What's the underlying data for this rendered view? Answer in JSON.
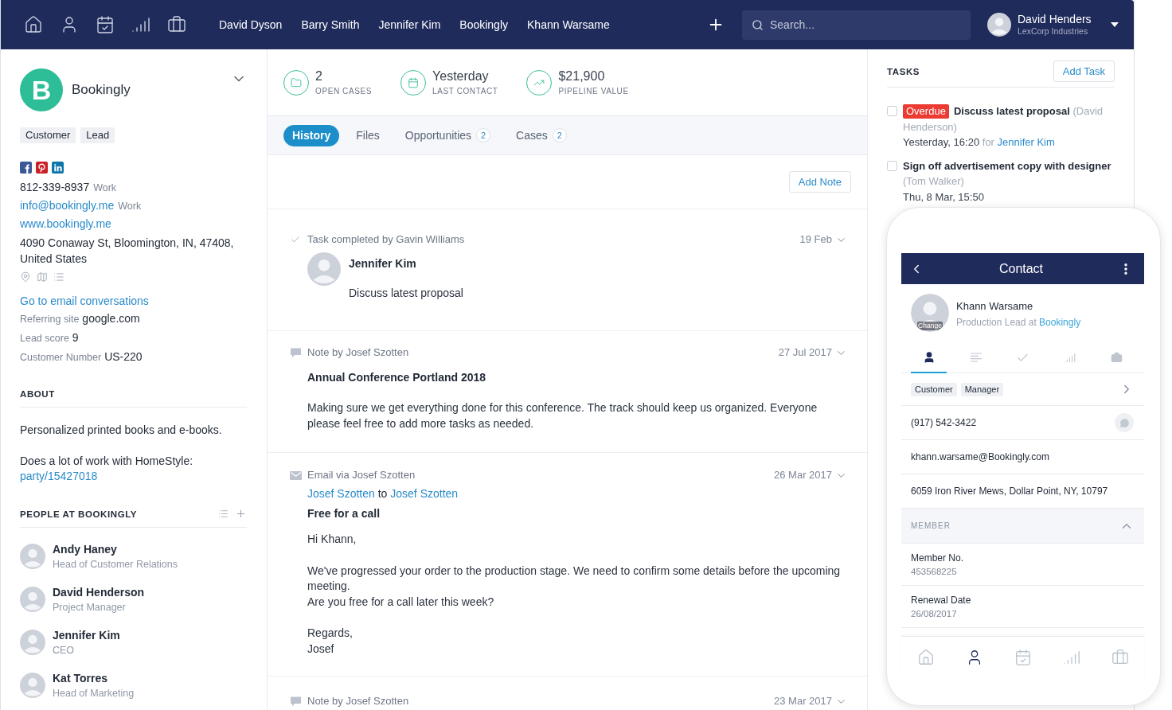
{
  "top_nav": {
    "links": [
      "David Dyson",
      "Barry Smith",
      "Jennifer Kim",
      "Bookingly",
      "Khann Warsame"
    ],
    "search": {
      "placeholder": "Search..."
    },
    "user": {
      "name": "David Henders",
      "company": "LexCorp Industries"
    }
  },
  "company": {
    "initial": "B",
    "name": "Bookingly",
    "tags": [
      "Customer",
      "Lead"
    ],
    "phone": {
      "number": "812-339-8937",
      "type": "Work"
    },
    "email": {
      "address": "info@bookingly.me",
      "type": "Work"
    },
    "website": "www.bookingly.me",
    "address": "4090 Conaway St, Bloomington, IN, 47408, United States",
    "email_link": "Go to email conversations",
    "fields": [
      {
        "label": "Referring site",
        "value": "google.com"
      },
      {
        "label": "Lead score",
        "value": "9"
      },
      {
        "label": "Customer Number",
        "value": "US-220"
      }
    ]
  },
  "about": {
    "heading": "ABOUT",
    "paragraphs": [
      {
        "text": "Personalized printed books and e-books."
      },
      {
        "text": "Does a lot of work with HomeStyle:",
        "link": "party/15427018"
      }
    ]
  },
  "people": {
    "heading": "PEOPLE AT BOOKINGLY",
    "items": [
      {
        "name": "Andy Haney",
        "role": "Head of Customer Relations"
      },
      {
        "name": "David Henderson",
        "role": "Project Manager"
      },
      {
        "name": "Jennifer Kim",
        "role": "CEO"
      },
      {
        "name": "Kat Torres",
        "role": "Head of Marketing"
      }
    ]
  },
  "stats": [
    {
      "value": "2",
      "label": "OPEN CASES"
    },
    {
      "value": "Yesterday",
      "label": "LAST CONTACT"
    },
    {
      "value": "$21,900",
      "label": "PIPELINE VALUE"
    }
  ],
  "tabs": [
    {
      "label": "History",
      "selected": true
    },
    {
      "label": "Files",
      "selected": false
    },
    {
      "label": "Opportunities",
      "count": "2",
      "selected": false
    },
    {
      "label": "Cases",
      "count": "2",
      "selected": false
    }
  ],
  "add_note": "Add Note",
  "history": [
    {
      "kind": "task",
      "header": "Task completed by Gavin Williams",
      "date": "19 Feb",
      "person": "Jennifer Kim",
      "text": "Discuss latest proposal"
    },
    {
      "kind": "note",
      "header": "Note by Josef Szotten",
      "date": "27 Jul 2017",
      "title": "Annual Conference Portland 2018",
      "body": "Making sure we get everything done for this conference. The track should keep us organized. Everyone please feel free to add more tasks as needed."
    },
    {
      "kind": "email",
      "header": "Email via Josef Szotten",
      "date": "26 Mar 2017",
      "from": "Josef Szotten",
      "connector": "to",
      "to": "Josef Szotten",
      "title": "Free for a call",
      "paragraphs": [
        [
          "Hi Khann,"
        ],
        [
          "We've progressed your order to the production stage. We need to confirm some details before the upcoming meeting.",
          "Are you free for a call later this week?"
        ],
        [
          "Regards,",
          "Josef"
        ]
      ]
    },
    {
      "kind": "note",
      "header": "Note by Josef Szotten",
      "date": "23 Mar 2017"
    }
  ],
  "tasks": {
    "heading": "TASKS",
    "add_button": "Add Task",
    "items": [
      {
        "checked": false,
        "badge": "Overdue",
        "title": "Discuss latest proposal",
        "assignee": "(David Henderson)",
        "due": "Yesterday, 16:20",
        "for": "for",
        "contact": "Jennifer Kim"
      },
      {
        "checked": false,
        "title": "Sign off advertisement copy with designer",
        "assignee": "(Tom Walker)",
        "due": "Thu, 8 Mar, 15:50"
      }
    ]
  },
  "mobile": {
    "title": "Contact",
    "contact": {
      "name": "Khann Warsame",
      "role": "Production Lead at",
      "company": "Bookingly",
      "photo_action": "Change"
    },
    "tabs": [
      {
        "selected": true
      },
      {
        "selected": false
      },
      {
        "selected": false
      },
      {
        "selected": false
      },
      {
        "selected": false
      }
    ],
    "tags": [
      "Customer",
      "Manager"
    ],
    "rows": [
      {
        "kind": "phone",
        "text": "(917) 542-3422"
      },
      {
        "kind": "email",
        "text": "khann.warsame@Bookingly.com"
      },
      {
        "kind": "address",
        "text": "6059 Iron River Mews, Dollar Point, NY, 10797"
      }
    ],
    "section": {
      "title": "MEMBER",
      "expanded": true,
      "fields": [
        {
          "label": "Member No.",
          "value": "453568225"
        },
        {
          "label": "Renewal Date",
          "value": "26/08/2017"
        }
      ]
    },
    "bottom_nav": [
      {
        "selected": false
      },
      {
        "selected": true
      },
      {
        "selected": false
      },
      {
        "selected": false
      },
      {
        "selected": false
      }
    ]
  }
}
